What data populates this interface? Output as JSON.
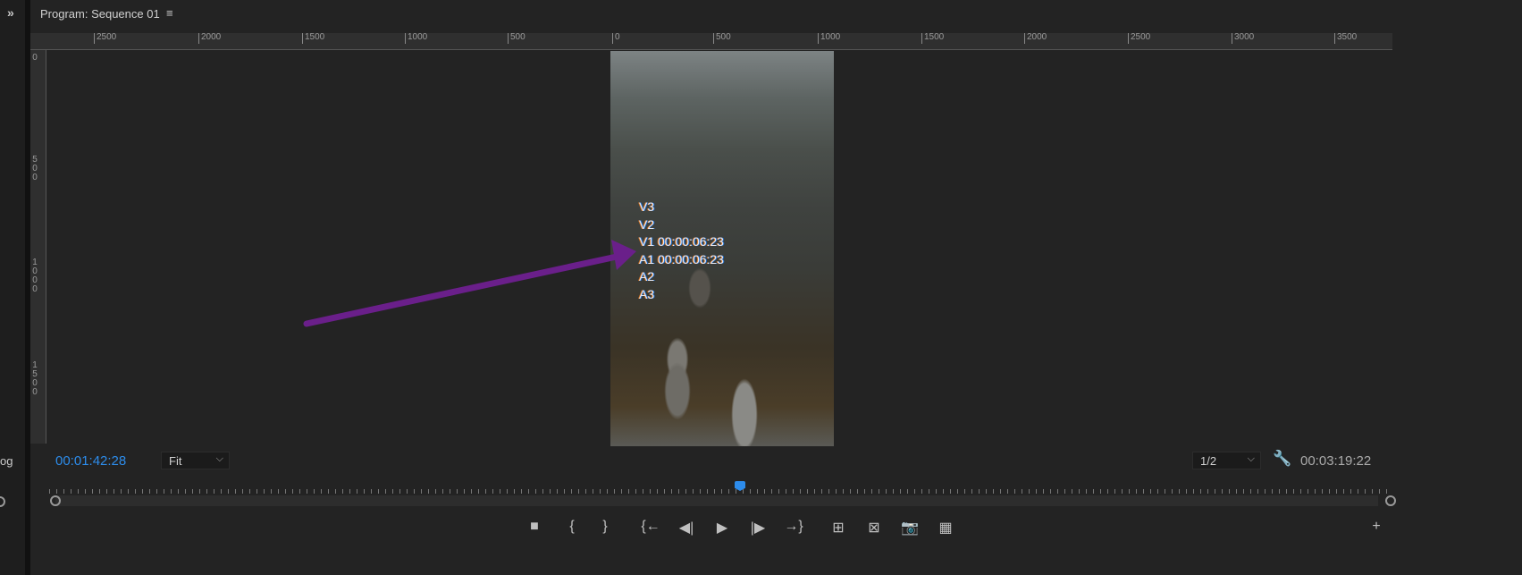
{
  "panel": {
    "title": "Program: Sequence 01",
    "menu_icon": "hamburger-icon",
    "expand_icon": "double-chevron-right-icon",
    "left_panel_text": "og"
  },
  "ruler": {
    "horizontal": [
      "2500",
      "2000",
      "1500",
      "1000",
      "500",
      "0",
      "500",
      "1000",
      "1500",
      "2000",
      "2500",
      "3000",
      "3500"
    ],
    "vertical": [
      "0",
      "500",
      "1000",
      "1500"
    ]
  },
  "overlay": {
    "lines": [
      "V3",
      "V2",
      "V1 00:00:06:23",
      "A1 00:00:06:23",
      "A2",
      "A3"
    ]
  },
  "annotation": {
    "arrow_color": "#6a1f8a"
  },
  "controls": {
    "current_timecode": "00:01:42:28",
    "zoom": "Fit",
    "resolution": "1/2",
    "duration": "00:03:19:22",
    "accent": "#2d8ceb"
  },
  "transport": [
    {
      "name": "add-marker",
      "glyph": "■"
    },
    {
      "name": "mark-in",
      "glyph": "{"
    },
    {
      "name": "mark-out",
      "glyph": "}"
    },
    {
      "name": "go-to-in",
      "glyph": "{←"
    },
    {
      "name": "step-back",
      "glyph": "◀|"
    },
    {
      "name": "play",
      "glyph": "▶"
    },
    {
      "name": "step-forward",
      "glyph": "|▶"
    },
    {
      "name": "go-to-out",
      "glyph": "→}"
    },
    {
      "name": "insert",
      "glyph": "⊞"
    },
    {
      "name": "overwrite",
      "glyph": "⊠"
    },
    {
      "name": "export-frame",
      "glyph": "📷"
    },
    {
      "name": "comparison-view",
      "glyph": "▦"
    },
    {
      "name": "button-editor",
      "glyph": "+"
    }
  ]
}
